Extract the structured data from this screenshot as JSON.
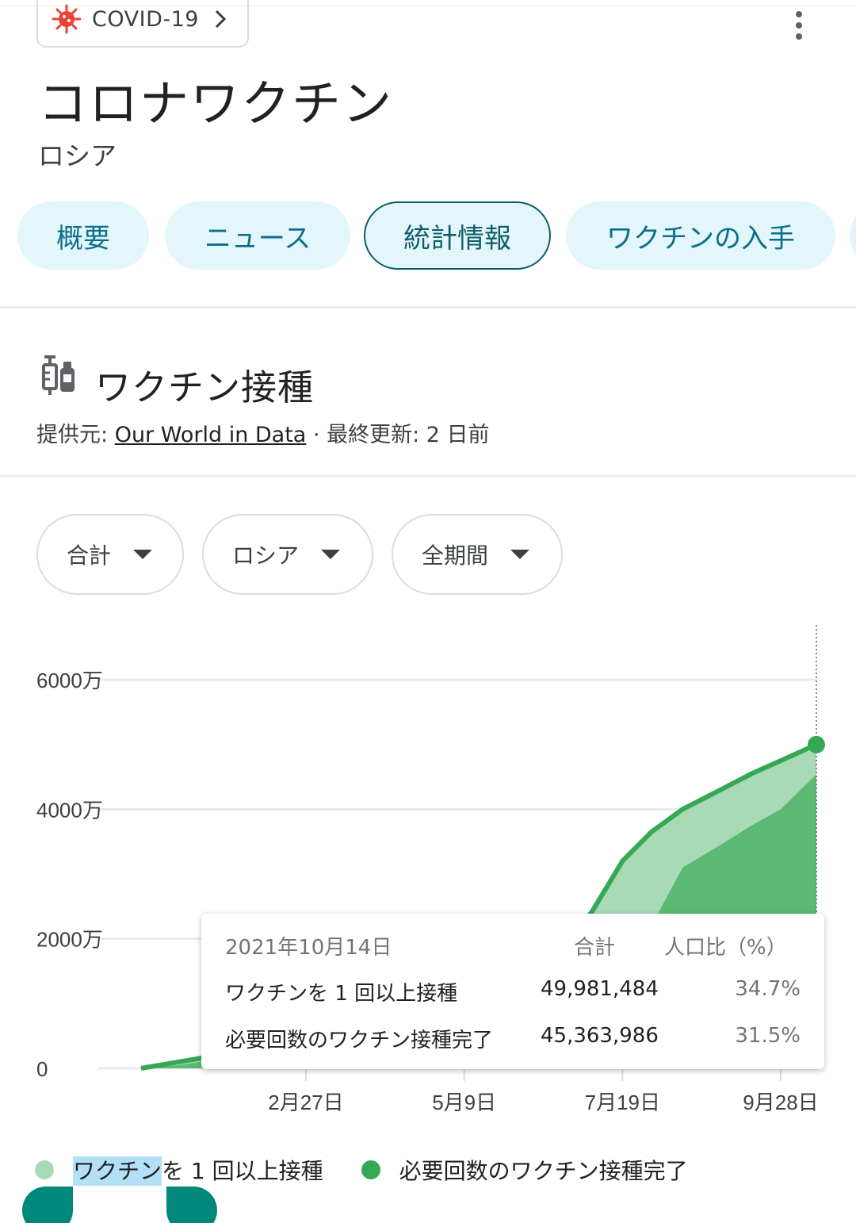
{
  "header": {
    "covid_chip_label": "COVID-19",
    "title": "コロナワクチン",
    "subtitle": "ロシア"
  },
  "tabs": [
    {
      "label": "概要"
    },
    {
      "label": "ニュース"
    },
    {
      "label": "統計情報"
    },
    {
      "label": "ワクチンの入手"
    }
  ],
  "section": {
    "title": "ワクチン接種",
    "source_prefix": "提供元: ",
    "source_link": "Our World in Data",
    "updated": " · 最終更新: 2 日前"
  },
  "filters": [
    {
      "label": "合計"
    },
    {
      "label": "ロシア"
    },
    {
      "label": "全期間"
    }
  ],
  "colors": {
    "accent": "#34a853",
    "first_dose": "#a8dab5",
    "fully": "#5bb974",
    "tab_bg": "#e3f6fb",
    "tab_text": "#0b6e8a",
    "virus": "#ea4335"
  },
  "chart_data": {
    "type": "area",
    "y_tick_labels": [
      "0",
      "2000万",
      "4000万",
      "6000万"
    ],
    "x_tick_labels": [
      "2月27日",
      "5月9日",
      "7月19日",
      "9月28日"
    ],
    "ylim": [
      0,
      60000000
    ],
    "x": [
      "2020-12-15",
      "2021-01-01",
      "2021-01-15",
      "2021-02-01",
      "2021-02-15",
      "2021-02-27",
      "2021-03-15",
      "2021-04-01",
      "2021-04-15",
      "2021-05-01",
      "2021-05-09",
      "2021-05-20",
      "2021-06-01",
      "2021-06-15",
      "2021-06-25",
      "2021-07-05",
      "2021-07-19",
      "2021-08-01",
      "2021-08-15",
      "2021-09-01",
      "2021-09-15",
      "2021-09-28",
      "2021-10-14"
    ],
    "series": [
      {
        "name": "ワクチンを 1 回以上接種",
        "values": [
          0,
          1000000,
          1800000,
          3000000,
          4500000,
          6000000,
          8000000,
          10000000,
          12000000,
          14000000,
          15000000,
          16000000,
          17000000,
          18500000,
          20500000,
          24000000,
          32000000,
          36500000,
          40000000,
          43000000,
          45500000,
          47500000,
          49981484
        ]
      },
      {
        "name": "必要回数のワクチン接種完了",
        "values": [
          0,
          500000,
          1200000,
          2000000,
          3000000,
          4200000,
          5500000,
          7000000,
          8500000,
          10000000,
          11000000,
          12000000,
          13000000,
          14000000,
          15000000,
          16500000,
          18500000,
          22000000,
          31000000,
          34500000,
          37500000,
          40000000,
          45363986
        ]
      }
    ],
    "grid": true,
    "legend_position": "bottom"
  },
  "tooltip": {
    "date": "2021年10月14日",
    "header_total": "合計",
    "header_pct": "人口比（%）",
    "rows": [
      {
        "name": "ワクチンを 1 回以上接種",
        "value": "49,981,484",
        "pct": "34.7%"
      },
      {
        "name": "必要回数のワクチン接種完了",
        "value": "45,363,986",
        "pct": "31.5%"
      }
    ]
  },
  "legend": {
    "first_highlight": "ワクチン",
    "first_rest": "を 1 回以上接種",
    "second": "必要回数のワクチン接種完了"
  }
}
